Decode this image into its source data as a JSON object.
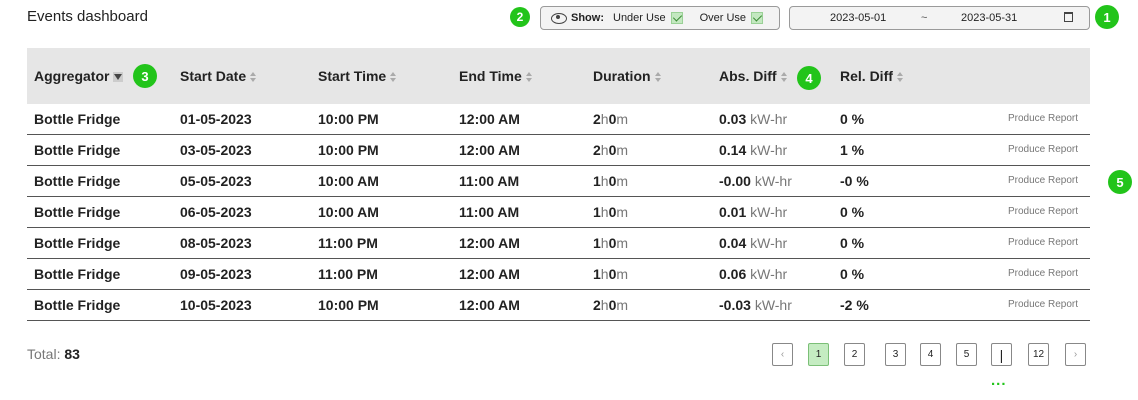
{
  "header": {
    "title": "Events dashboard"
  },
  "show_filter": {
    "label": "Show:",
    "under_use_label": "Under Use",
    "under_use_checked": true,
    "over_use_label": "Over Use",
    "over_use_checked": true
  },
  "date_range": {
    "from": "2023-05-01",
    "separator": "~",
    "to": "2023-05-31"
  },
  "annotations": [
    "1",
    "2",
    "3",
    "4",
    "5"
  ],
  "table": {
    "columns": [
      "Aggregator",
      "Start Date",
      "Start Time",
      "End Time",
      "Duration",
      "Abs. Diff",
      "Rel. Diff"
    ],
    "action_label": "Produce Report",
    "rows": [
      {
        "aggregator": "Bottle Fridge",
        "start_date": "01-05-2023",
        "start_time": "10:00 PM",
        "end_time": "12:00 AM",
        "dur_h": "2",
        "dur_h_unit": "h",
        "dur_m": "0",
        "dur_m_unit": "m",
        "abs": "0.03",
        "abs_unit": "kW-hr",
        "rel": "0 %"
      },
      {
        "aggregator": "Bottle Fridge",
        "start_date": "03-05-2023",
        "start_time": "10:00 PM",
        "end_time": "12:00 AM",
        "dur_h": "2",
        "dur_h_unit": "h",
        "dur_m": "0",
        "dur_m_unit": "m",
        "abs": "0.14",
        "abs_unit": "kW-hr",
        "rel": "1 %"
      },
      {
        "aggregator": "Bottle Fridge",
        "start_date": "05-05-2023",
        "start_time": "10:00 AM",
        "end_time": "11:00 AM",
        "dur_h": "1",
        "dur_h_unit": "h",
        "dur_m": "0",
        "dur_m_unit": "m",
        "abs": "-0.00",
        "abs_unit": "kW-hr",
        "rel": "-0 %"
      },
      {
        "aggregator": "Bottle Fridge",
        "start_date": "06-05-2023",
        "start_time": "10:00 AM",
        "end_time": "11:00 AM",
        "dur_h": "1",
        "dur_h_unit": "h",
        "dur_m": "0",
        "dur_m_unit": "m",
        "abs": "0.01",
        "abs_unit": "kW-hr",
        "rel": "0 %"
      },
      {
        "aggregator": "Bottle Fridge",
        "start_date": "08-05-2023",
        "start_time": "11:00 PM",
        "end_time": "12:00 AM",
        "dur_h": "1",
        "dur_h_unit": "h",
        "dur_m": "0",
        "dur_m_unit": "m",
        "abs": "0.04",
        "abs_unit": "kW-hr",
        "rel": "0 %"
      },
      {
        "aggregator": "Bottle Fridge",
        "start_date": "09-05-2023",
        "start_time": "11:00 PM",
        "end_time": "12:00 AM",
        "dur_h": "1",
        "dur_h_unit": "h",
        "dur_m": "0",
        "dur_m_unit": "m",
        "abs": "0.06",
        "abs_unit": "kW-hr",
        "rel": "0 %"
      },
      {
        "aggregator": "Bottle Fridge",
        "start_date": "10-05-2023",
        "start_time": "10:00 PM",
        "end_time": "12:00 AM",
        "dur_h": "2",
        "dur_h_unit": "h",
        "dur_m": "0",
        "dur_m_unit": "m",
        "abs": "-0.03",
        "abs_unit": "kW-hr",
        "rel": "-2 %"
      }
    ]
  },
  "footer": {
    "total_label": "Total:",
    "total_value": "83"
  },
  "pagination": {
    "prev": "‹",
    "pages": [
      "1",
      "2",
      "3",
      "4",
      "5",
      "|",
      "12"
    ],
    "active_page": "1",
    "next": "›",
    "ellipsis": "..."
  }
}
